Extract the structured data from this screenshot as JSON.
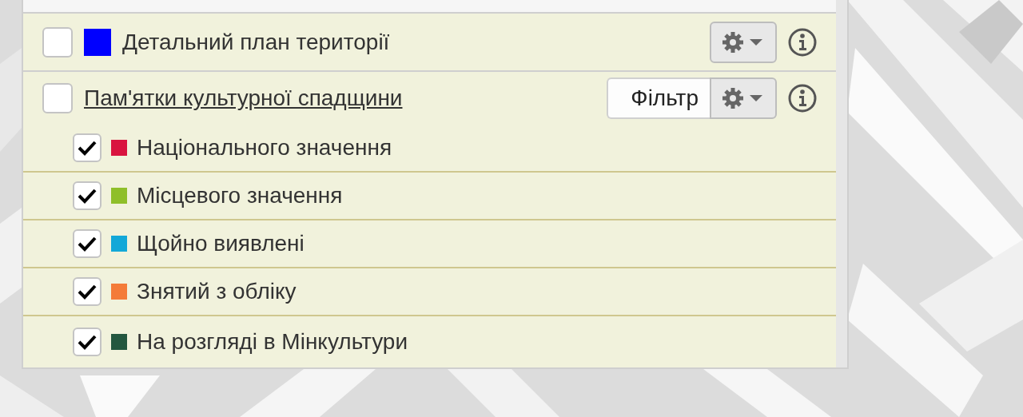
{
  "layers": [
    {
      "kind": "plain",
      "label": "Детальний план території",
      "checked": false,
      "color": "#0000ff"
    },
    {
      "kind": "group",
      "label": "Пам'ятки культурної спадщини",
      "checked": false,
      "filter_button": "Фільтр",
      "children": [
        {
          "label": "Національного значення",
          "checked": true,
          "color": "#d9143f"
        },
        {
          "label": "Місцевого значення",
          "checked": true,
          "color": "#8fbf2a"
        },
        {
          "label": "Щойно виявлені",
          "checked": true,
          "color": "#13a8d8"
        },
        {
          "label": "Знятий з обліку",
          "checked": true,
          "color": "#f47b38"
        },
        {
          "label": "На розгляді в Мінкультури",
          "checked": true,
          "color": "#23573f"
        }
      ]
    }
  ]
}
